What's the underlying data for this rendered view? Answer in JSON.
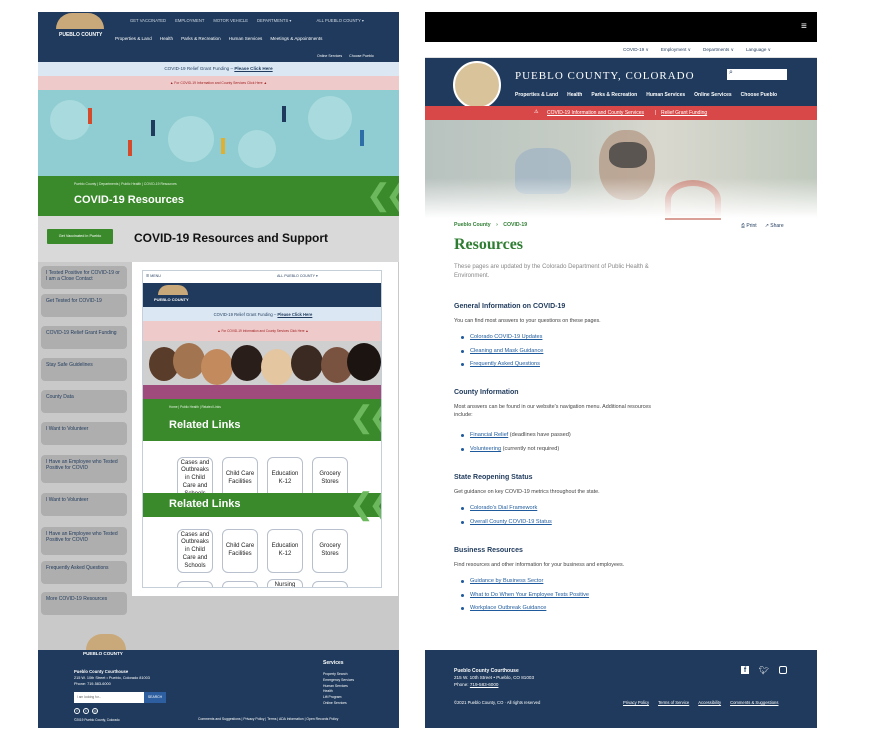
{
  "left": {
    "top_nav": [
      "GET VACCINATED",
      "EMPLOYMENT",
      "MOTOR VEHICLE",
      "DEPARTMENTS ▾",
      "ALL PUEBLO COUNTY ▾"
    ],
    "logo_text": "PUEBLO COUNTY",
    "main_nav": [
      "Properties & Land",
      "Health",
      "Parks & Recreation",
      "Human Services",
      "Meetings & Appointments"
    ],
    "sub_nav": [
      "Online Services",
      "Choose Pueblo"
    ],
    "banner_text": "COVID-19 Relief Grant Funding – ",
    "banner_link": "Please Click Here",
    "alert_text": "▲ For COVID-19 Information and County Services Click Here ▲",
    "breadcrumb": "Pueblo County  |  Departments  |  Public Health  |  COVID-19 Resources",
    "hero_title": "COVID-19 Resources",
    "vaccine_button": "Get Vaccinated in Pueblo",
    "page_title": "COVID-19 Resources and Support",
    "sidebar": [
      "I Tested Positive for COVID-19 or I am a Close Contact",
      "Get Tested for COVID-19",
      "COVID-19 Relief Grant Funding",
      "Stay Safe Guidelines",
      "County Data",
      "I Want to Volunteer",
      "I Have an Employee who Tested Positive for COVID",
      "I Want to Volunteer",
      "I Have an Employee who Tested Positive for COVID",
      "Frequently Asked Questions",
      "More COVID-19 Resources"
    ],
    "mobile": {
      "menu": "☰ MENU",
      "select": "ALL PUEBLO COUNTY ▾",
      "logo_text": "PUEBLO COUNTY",
      "banner_text": "COVID-19 Relief Grant Funding – ",
      "banner_link": "Please Click Here",
      "alert_text": "▲ For COVID-19 Information and County Services Click Here ▲",
      "breadcrumb": "Home  |  Public Health  |  Related Links",
      "related_title": "Related Links",
      "cards_row1": [
        "Cases and Outbreaks in Child Care and Schools",
        "Child Care Facilities",
        "Education K-12",
        "Grocery Stores"
      ],
      "cards_row2": [
        "Cases and Outbreaks in Child Care and Schools",
        "Child Care Facilities",
        "Education K-12",
        "Grocery Stores"
      ],
      "partial_card": "Nursing"
    },
    "footer": {
      "logo_text": "PUEBLO COUNTY",
      "org": "Pueblo County Courthouse",
      "address": "215 W. 10th Street • Pueblo, Colorado 81003",
      "phone": "Phone: 719-583-6000",
      "search_placeholder": "I am looking for...",
      "search_button": "SEARCH",
      "copyright": "©2019 Pueblo County, Colorado",
      "services_title": "Services",
      "services": [
        "Property Search",
        "Emergency Services",
        "Human Services",
        "Health",
        "Lift Program",
        "Online Services"
      ],
      "legal": "Comments and Suggestions  |  Privacy Policy  |  Terms  |  ADA Information  |  Open Records Policy"
    }
  },
  "right": {
    "utility_nav": [
      "COVID-19 ∨",
      "Employment ∨",
      "Departments ∨",
      "Language ∨"
    ],
    "site_title": "PUEBLO COUNTY, COLORADO",
    "main_nav": [
      "Properties & Land",
      "Health",
      "Parks & Recreation",
      "Human Services",
      "Online Services",
      "Choose Pueblo"
    ],
    "alert_link1": "COVID-19 Information and County Services",
    "alert_link2": "Relief Grant Funding",
    "breadcrumb_home": "Pueblo County",
    "breadcrumb_current": "COVID-19",
    "print": "Print",
    "share": "Share",
    "title": "Resources",
    "intro": "These pages are updated by the Colorado Department of Public Health & Environment.",
    "sections": [
      {
        "heading": "General Information on COVID-19",
        "text": "You can find most answers to your questions on these pages.",
        "links": [
          {
            "link": "Colorado COVID-19 Updates",
            "note": ""
          },
          {
            "link": "Cleaning and Mask Guidance",
            "note": ""
          },
          {
            "link": "Frequently Asked Questions",
            "note": ""
          }
        ]
      },
      {
        "heading": "County Information",
        "text": "Most answers can be found in our website's navigation menu. Additional resources include:",
        "links": [
          {
            "link": "Financial Relief",
            "note": " (deadlines have passed)"
          },
          {
            "link": "Volunteering",
            "note": " (currently not required)"
          }
        ]
      },
      {
        "heading": "State Reopening Status",
        "text": "Get guidance on key COVID-19 metrics throughout the state.",
        "links": [
          {
            "link": "Colorado's Dial Framework",
            "note": ""
          },
          {
            "link": "Overall County COVID-19 Status",
            "note": ""
          }
        ]
      },
      {
        "heading": "Business Resources",
        "text": "Find resources and other information for your business and employees.",
        "links": [
          {
            "link": "Guidance by Business Sector",
            "note": ""
          },
          {
            "link": "What to Do When Your Employee Tests Positive",
            "note": ""
          },
          {
            "link": "Workplace Outbreak Guidance",
            "note": ""
          }
        ]
      }
    ],
    "footer": {
      "org": "Pueblo County Courthouse",
      "address": "215 W. 10th Street • Pueblo, CO 81003",
      "phone_label": "Phone: ",
      "phone": "719-583-6000",
      "copyright": "©2021 Pueblo County, CO · All rights reserved",
      "links": [
        "Privacy Policy",
        "Terms of Service",
        "Accessibility",
        "Comments & Suggestions"
      ]
    }
  },
  "colors": {
    "navy": "#1f3a5c",
    "green": "#3a8a2b",
    "alert_red": "#d94848",
    "link": "#1e5a9c",
    "heading_green": "#2f7d32"
  }
}
